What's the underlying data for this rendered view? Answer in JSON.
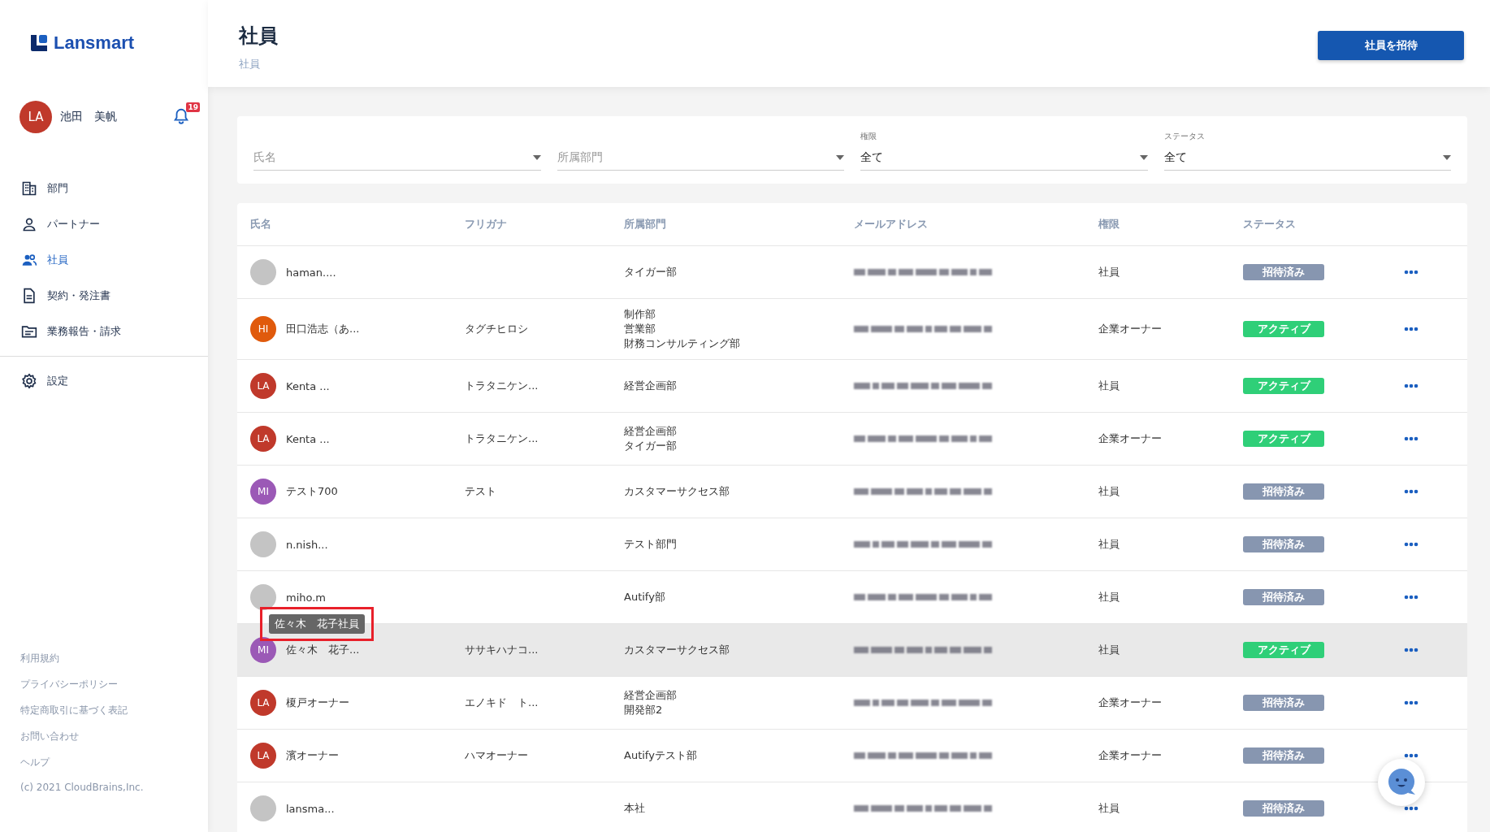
{
  "sidebar": {
    "logo": "Lansmart",
    "user": {
      "initials": "LA",
      "name": "池田　美帆",
      "color": "#c0392b"
    },
    "notifications": {
      "count": "19"
    },
    "nav": [
      {
        "label": "部門",
        "selected": false
      },
      {
        "label": "パートナー",
        "selected": false
      },
      {
        "label": "社員",
        "selected": true
      },
      {
        "label": "契約・発注書",
        "selected": false
      },
      {
        "label": "業務報告・請求",
        "selected": false
      }
    ],
    "settings": {
      "label": "設定",
      "selected": false
    },
    "footer_links": [
      "利用規約",
      "プライバシーポリシー",
      "特定商取引に基づく表記",
      "お問い合わせ",
      "ヘルプ"
    ],
    "copyright": "(c) 2021 CloudBrains,Inc."
  },
  "header": {
    "title": "社員",
    "breadcrumb": "社員",
    "invite_button": "社員を招待"
  },
  "filters": [
    {
      "placeholder": "氏名"
    },
    {
      "placeholder": "所属部門"
    },
    {
      "label": "権限",
      "value": "全て"
    },
    {
      "label": "ステータス",
      "value": "全て"
    }
  ],
  "table": {
    "columns": [
      "氏名",
      "フリガナ",
      "所属部門",
      "メールアドレス",
      "権限",
      "ステータス"
    ],
    "rows": [
      {
        "avatar": {
          "color": "#c4c4c4"
        },
        "name": "haman....",
        "departments": [
          "タイガー部"
        ],
        "email": {
          "kind": "blurred"
        },
        "role": "社員",
        "status": {
          "label": "招待済み",
          "kind": "invited"
        },
        "hovered": false
      },
      {
        "avatar": {
          "initials": "HI",
          "color": "#e05a0c"
        },
        "name": "田口浩志（あ...",
        "furigana": "タグチヒロシ",
        "departments": [
          "制作部",
          "営業部",
          "財務コンサルティング部"
        ],
        "email": {
          "kind": "blurred"
        },
        "role": "企業オーナー",
        "status": {
          "label": "アクティブ",
          "kind": "active"
        },
        "hovered": false
      },
      {
        "avatar": {
          "initials": "LA",
          "color": "#c0392b"
        },
        "name": "Kenta ...",
        "furigana": "トラタニケン...",
        "departments": [
          "経営企画部"
        ],
        "email": {
          "kind": "blurred"
        },
        "role": "社員",
        "status": {
          "label": "アクティブ",
          "kind": "active"
        },
        "hovered": false
      },
      {
        "avatar": {
          "initials": "LA",
          "color": "#c0392b"
        },
        "name": "Kenta ...",
        "furigana": "トラタニケン...",
        "departments": [
          "経営企画部",
          "タイガー部"
        ],
        "email": {
          "kind": "blurred"
        },
        "role": "企業オーナー",
        "status": {
          "label": "アクティブ",
          "kind": "active"
        },
        "hovered": false
      },
      {
        "avatar": {
          "initials": "MI",
          "color": "#9b59b6"
        },
        "name": "テスト700",
        "furigana": "テスト",
        "departments": [
          "カスタマーサクセス部"
        ],
        "email": {
          "kind": "blurred"
        },
        "role": "社員",
        "status": {
          "label": "招待済み",
          "kind": "invited"
        },
        "hovered": false
      },
      {
        "avatar": {
          "color": "#c4c4c4"
        },
        "name": "n.nish...",
        "departments": [
          "テスト部門"
        ],
        "email": {
          "kind": "blurred"
        },
        "role": "社員",
        "status": {
          "label": "招待済み",
          "kind": "invited"
        },
        "hovered": false
      },
      {
        "avatar": {
          "color": "#c4c4c4"
        },
        "name": "miho.m",
        "departments": [
          "Autify部"
        ],
        "email": {
          "kind": "blurred"
        },
        "role": "社員",
        "status": {
          "label": "招待済み",
          "kind": "invited"
        },
        "hovered": false
      },
      {
        "avatar": {
          "initials": "MI",
          "color": "#9b59b6"
        },
        "name": "佐々木　花子...",
        "furigana": "ササキハナコ...",
        "departments": [
          "カスタマーサクセス部"
        ],
        "email": {
          "kind": "blurred"
        },
        "role": "社員",
        "status": {
          "label": "アクティブ",
          "kind": "active"
        },
        "hovered": true,
        "tooltip": {
          "text": "佐々木　花子社員",
          "highlighted": true
        }
      },
      {
        "avatar": {
          "initials": "LA",
          "color": "#c0392b"
        },
        "name": "榎戸オーナー",
        "furigana": "エノキド　ト...",
        "departments": [
          "経営企画部",
          "開発部2"
        ],
        "email": {
          "kind": "blurred"
        },
        "role": "企業オーナー",
        "status": {
          "label": "招待済み",
          "kind": "invited"
        },
        "hovered": false
      },
      {
        "avatar": {
          "initials": "LA",
          "color": "#c0392b"
        },
        "name": "濱オーナー",
        "furigana": "ハマオーナー",
        "departments": [
          "Autifyテスト部"
        ],
        "email": {
          "kind": "blurred"
        },
        "role": "企業オーナー",
        "status": {
          "label": "招待済み",
          "kind": "invited"
        },
        "hovered": false
      },
      {
        "avatar": {
          "color": "#c4c4c4"
        },
        "name": "lansma...",
        "departments": [
          "本社"
        ],
        "email": {
          "kind": "blurred"
        },
        "role": "社員",
        "status": {
          "label": "招待済み",
          "kind": "invited"
        },
        "hovered": false
      }
    ]
  }
}
